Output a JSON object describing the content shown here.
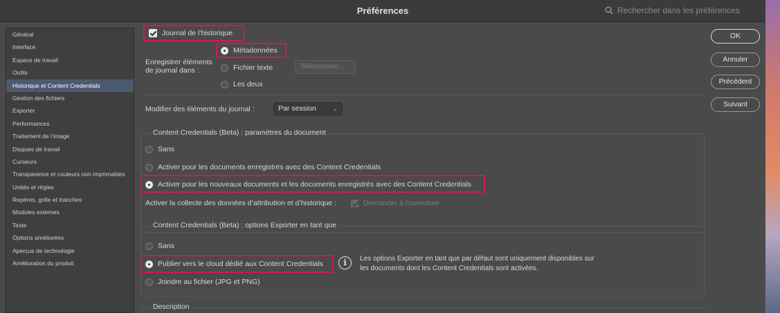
{
  "window": {
    "title": "Préférences",
    "search_placeholder": "Rechercher dans les préférences"
  },
  "sidebar": {
    "items": [
      "Général",
      "Interface",
      "Espace de travail",
      "Outils",
      "Historique et Content Credentials",
      "Gestion des fichiers",
      "Exporter",
      "Performances",
      "Traitement de l’image",
      "Disques de travail",
      "Curseurs",
      "Transparence et couleurs non imprimables",
      "Unités et règles",
      "Repères, grille et tranches",
      "Modules externes",
      "Texte",
      "Options améliorées",
      "Aperçus de technologie",
      "Amélioration du produit"
    ],
    "active_index": 4
  },
  "history": {
    "journal_label": "Journal de l’historique",
    "journal_checked": true,
    "save_items_label_line1": "Enregistrer éléments",
    "save_items_label_line2": "de journal dans :",
    "options": [
      "Métadonnées",
      "Fichier texte",
      "Les deux"
    ],
    "selected_option": "Métadonnées",
    "select_button": "Sélectionner...",
    "modify_label": "Modifier des éléments du journal :",
    "modify_value": "Par session"
  },
  "doc_settings": {
    "title": "Content Credentials (Beta) : paramètres du document",
    "options": [
      "Sans",
      "Activer pour les documents enregistrés avec des Content Credentials",
      "Activer pour les nouveaux documents et les documents enregistrés avec des Content Credentials"
    ],
    "selected_index": 2,
    "collect_label": "Activer la collecte des données d’attribution et d’historique :",
    "ask_label": "Demander à l’ouverture"
  },
  "export_settings": {
    "title": "Content Credentials (Beta) : options Exporter en tant que",
    "options": [
      "Sans",
      "Publier vers le cloud dédié aux Content Credentials",
      "Joindre au fichier (JPG et PNG)"
    ],
    "selected_index": 1,
    "info_line1": "Les options Exporter en tant que par défaut sont uniquement disponibles sur",
    "info_line2": "les documents dont les Content Credentials sont activées."
  },
  "description": {
    "title": "Description"
  },
  "buttons": {
    "ok": "OK",
    "cancel": "Annuler",
    "previous": "Précédent",
    "next": "Suivant"
  },
  "colors": {
    "highlight": "#d01c4a",
    "sidebar_active": "#4c5a70",
    "background": "#4a4a4a"
  }
}
